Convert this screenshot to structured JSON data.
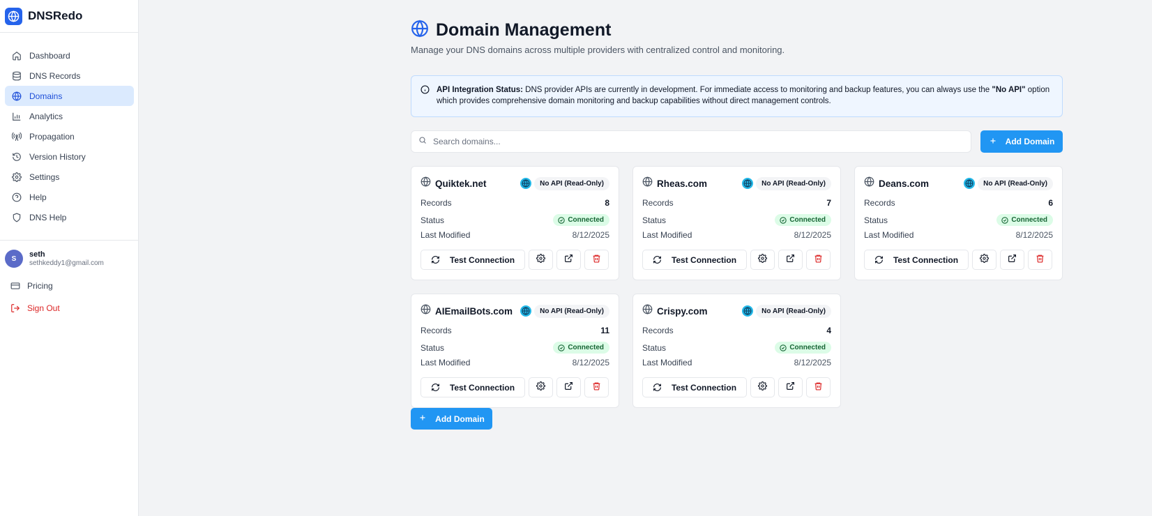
{
  "brand": {
    "name": "DNSRedo"
  },
  "nav": [
    {
      "label": "Dashboard",
      "icon": "home-icon",
      "active": false
    },
    {
      "label": "DNS Records",
      "icon": "database-icon",
      "active": false
    },
    {
      "label": "Domains",
      "icon": "globe-icon",
      "active": true
    },
    {
      "label": "Analytics",
      "icon": "bar-chart-icon",
      "active": false
    },
    {
      "label": "Propagation",
      "icon": "radio-tower-icon",
      "active": false
    },
    {
      "label": "Version History",
      "icon": "history-icon",
      "active": false
    },
    {
      "label": "Settings",
      "icon": "gear-icon",
      "active": false
    },
    {
      "label": "Help",
      "icon": "help-circle-icon",
      "active": false
    },
    {
      "label": "DNS Help",
      "icon": "shield-icon",
      "active": false
    }
  ],
  "user": {
    "initial": "S",
    "name": "seth",
    "email": "sethkeddy1@gmail.com"
  },
  "links": {
    "pricing": "Pricing",
    "signout": "Sign Out"
  },
  "header": {
    "title": "Domain Management",
    "subtitle": "Manage your DNS domains across multiple providers with centralized control and monitoring."
  },
  "alert": {
    "label": "API Integration Status:",
    "text1": " DNS provider APIs are currently in development. For immediate access to monitoring and backup features, you can always use the ",
    "strong": "\"No API\"",
    "text2": " option which provides comprehensive domain monitoring and backup capabilities without direct management controls."
  },
  "search": {
    "placeholder": "Search domains..."
  },
  "add_domain_label": "Add Domain",
  "card_labels": {
    "records": "Records",
    "status": "Status",
    "last_modified": "Last Modified",
    "test": "Test Connection"
  },
  "colors": {
    "accent": "#2196f3",
    "active_nav_bg": "#dbeafe",
    "connected_bg": "#dcfce7",
    "danger": "#dc2626"
  },
  "domains": [
    {
      "name": "Quiktek.net",
      "api": "No API (Read-Only)",
      "records": "8",
      "status": "Connected",
      "modified": "8/12/2025"
    },
    {
      "name": "Rheas.com",
      "api": "No API (Read-Only)",
      "records": "7",
      "status": "Connected",
      "modified": "8/12/2025"
    },
    {
      "name": "Deans.com",
      "api": "No API (Read-Only)",
      "records": "6",
      "status": "Connected",
      "modified": "8/12/2025"
    },
    {
      "name": "AIEmailBots.com",
      "api": "No API (Read-Only)",
      "records": "11",
      "status": "Connected",
      "modified": "8/12/2025"
    },
    {
      "name": "Crispy.com",
      "api": "No API (Read-Only)",
      "records": "4",
      "status": "Connected",
      "modified": "8/12/2025"
    }
  ]
}
